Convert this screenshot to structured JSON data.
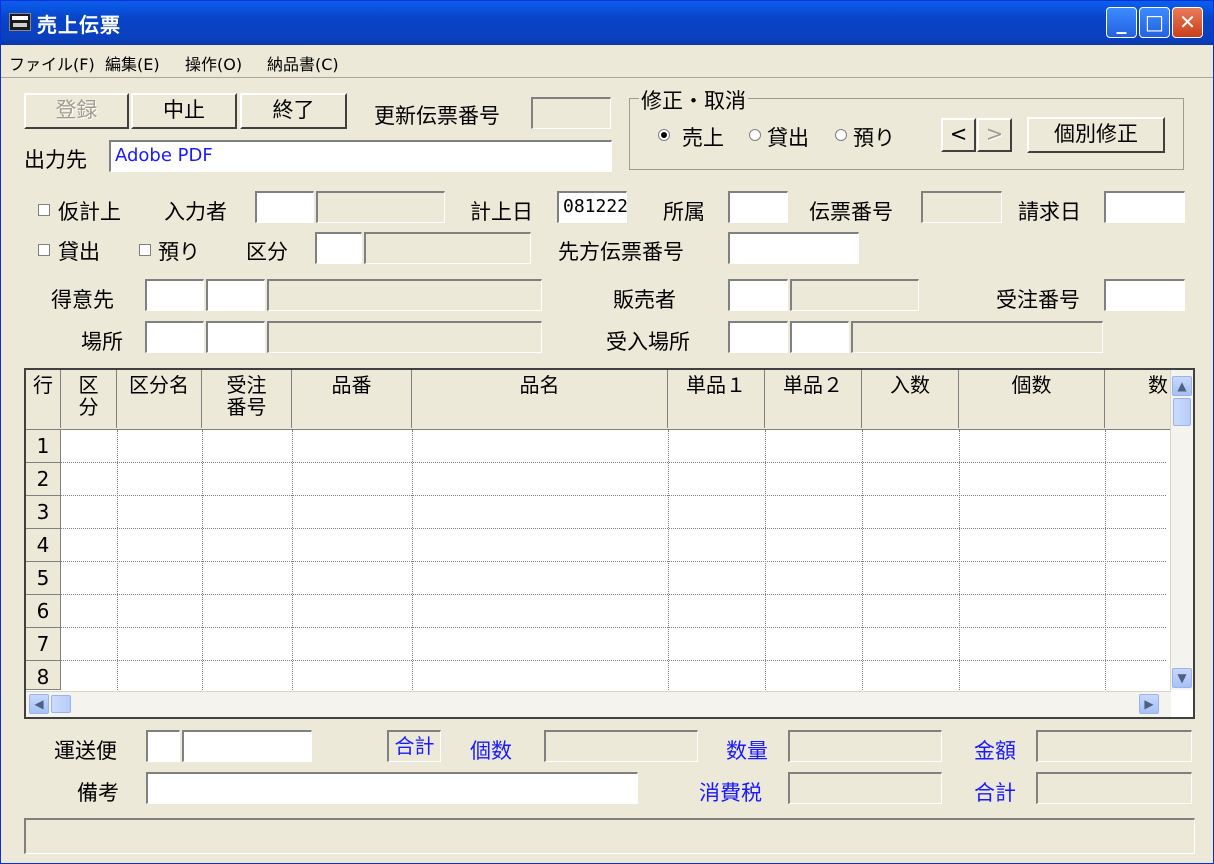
{
  "window": {
    "title": "売上伝票",
    "controls": {
      "minimize": "_",
      "maximize": "□",
      "close": "✕"
    }
  },
  "menu": [
    "ファイル(F)",
    "編集(E)",
    "操作(O)",
    "納品書(C)"
  ],
  "toolbar": {
    "register_label": "登録",
    "stop_label": "中止",
    "exit_label": "終了",
    "update_no_label": "更新伝票番号",
    "output_label": "出力先",
    "output_value": "Adobe PDF"
  },
  "correction": {
    "group_title": "修正・取消",
    "options": [
      "売上",
      "貸出",
      "預り"
    ],
    "selected": "売上",
    "prev": "<",
    "next": ">",
    "individual_label": "個別修正"
  },
  "form": {
    "provisional": "仮計上",
    "inputter": "入力者",
    "posting_date_label": "計上日",
    "posting_date_value": "081222",
    "dept": "所属",
    "slip_no": "伝票番号",
    "billing_date": "請求日",
    "lend": "貸出",
    "deposit": "預り",
    "category": "区分",
    "partner_slip_no": "先方伝票番号",
    "customer": "得意先",
    "seller": "販売者",
    "order_no": "受注番号",
    "location": "場所",
    "receive_location": "受入場所"
  },
  "grid": {
    "headers": [
      [
        "行"
      ],
      [
        "区",
        "分"
      ],
      [
        "区分名"
      ],
      [
        "受注",
        "番号"
      ],
      [
        "品番"
      ],
      [
        "品名"
      ],
      [
        "単品１"
      ],
      [
        "単品２"
      ],
      [
        "入数"
      ],
      [
        "個数"
      ],
      [
        "数"
      ]
    ],
    "rows": [
      "1",
      "2",
      "3",
      "4",
      "5",
      "6",
      "7",
      "8"
    ]
  },
  "footer": {
    "carrier": "運送便",
    "total_tag": "合計",
    "qty_pieces": "個数",
    "quantity": "数量",
    "amount": "金額",
    "remarks": "備考",
    "tax": "消費税",
    "total": "合計"
  },
  "colors": {
    "titlebar": "#0A5FEF",
    "face": "#ECE9D8",
    "accent_text": "#1A1AFF"
  }
}
